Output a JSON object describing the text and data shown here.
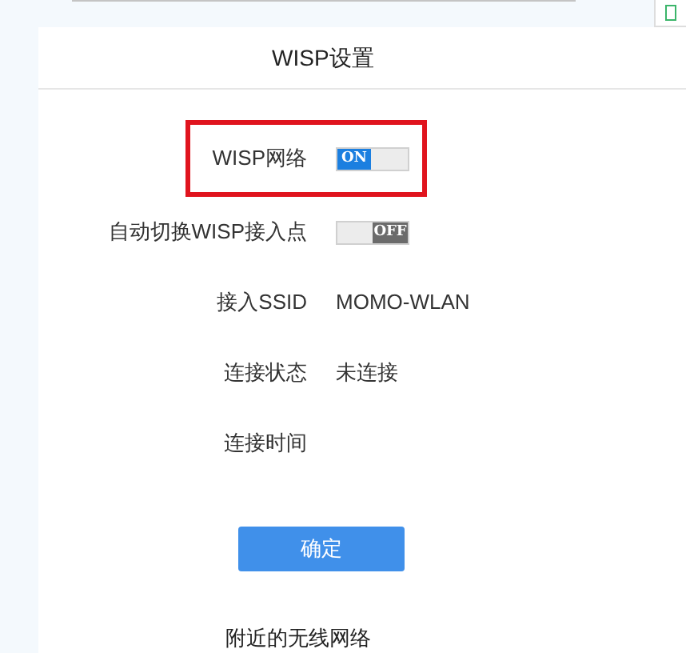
{
  "panel": {
    "title": "WISP设置"
  },
  "rows": [
    {
      "kind": "toggle",
      "label": "WISP网络",
      "on": true,
      "toggle_text": "ON",
      "highlighted": true
    },
    {
      "kind": "toggle",
      "label": "自动切换WISP接入点",
      "on": false,
      "toggle_text": "OFF",
      "highlighted": false
    },
    {
      "kind": "text",
      "label": "接入SSID",
      "value": "MOMO-WLAN"
    },
    {
      "kind": "text",
      "label": "连接状态",
      "value": "未连接"
    },
    {
      "kind": "text",
      "label": "连接时间"
    }
  ],
  "confirm_button": "确定",
  "section_heading": "附近的无线网络"
}
